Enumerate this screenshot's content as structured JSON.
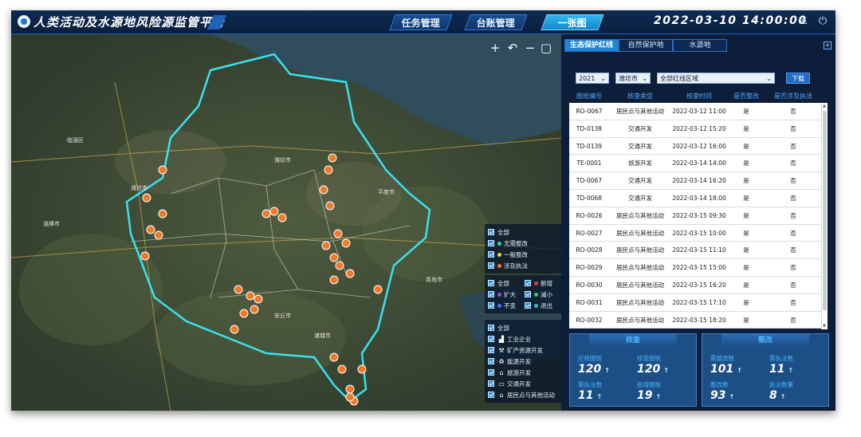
{
  "header": {
    "title": "人类活动及水源地风险源监管平台",
    "nav": [
      "任务管理",
      "台账管理",
      "一张图"
    ],
    "active_nav": 2,
    "datetime": "2022-03-10  14:00:00"
  },
  "map": {
    "controls": [
      "+",
      "↶",
      "−",
      "▢"
    ],
    "legend_status": [
      {
        "label": "全部",
        "color": ""
      },
      {
        "label": "无需整改",
        "color": "#2bd4c2"
      },
      {
        "label": "一般整改",
        "color": "#f2d33a"
      },
      {
        "label": "涉及执法",
        "color": "#f07a2a"
      }
    ],
    "legend_change": [
      {
        "label": "全部",
        "color": ""
      },
      {
        "label": "新增",
        "color": "#e23c3c"
      },
      {
        "label": "扩大",
        "color": "#a24cd8"
      },
      {
        "label": "减小",
        "color": "#2bd46a"
      },
      {
        "label": "不变",
        "color": "#3a7ff0"
      },
      {
        "label": "退出",
        "color": "#2bc4d4"
      }
    ],
    "legend_type": [
      {
        "label": "全部",
        "icon": ""
      },
      {
        "label": "工业企业",
        "icon": "factory-icon"
      },
      {
        "label": "矿产资源开发",
        "icon": "mining-icon"
      },
      {
        "label": "能源开发",
        "icon": "recycle-icon"
      },
      {
        "label": "旅游开发",
        "icon": "tourism-icon"
      },
      {
        "label": "交通开发",
        "icon": "bus-icon"
      },
      {
        "label": "居民点与其他活动",
        "icon": "residence-icon"
      }
    ]
  },
  "panel": {
    "tabs": [
      "生态保护红线",
      "自然保护地",
      "水源地"
    ],
    "active_tab": 0,
    "filters": {
      "year": "2021",
      "city": "潍坊市",
      "area": "全部红线区域"
    },
    "download_label": "下载",
    "columns": [
      "图斑编号",
      "核查类型",
      "核查时间",
      "是否整改",
      "是否涉及执法"
    ],
    "rows": [
      [
        "RO-0067",
        "居民点与其他活动",
        "2022-03-12 11:00",
        "是",
        "否"
      ],
      [
        "TD-0138",
        "交通开发",
        "2022-03-12 15:20",
        "是",
        "否"
      ],
      [
        "TD-0139",
        "交通开发",
        "2022-03-12 16:00",
        "是",
        "否"
      ],
      [
        "TE-0001",
        "旅游开发",
        "2022-03-14 14:00",
        "是",
        "否"
      ],
      [
        "TD-0067",
        "交通开发",
        "2022-03-14 16:20",
        "是",
        "否"
      ],
      [
        "TD-0068",
        "交通开发",
        "2022-03-14 18:00",
        "是",
        "否"
      ],
      [
        "RO-0026",
        "居民点与其他活动",
        "2022-03-15 09:30",
        "是",
        "否"
      ],
      [
        "RO-0027",
        "居民点与其他活动",
        "2022-03-15 10:00",
        "是",
        "否"
      ],
      [
        "RO-0028",
        "居民点与其他活动",
        "2022-03-15 11:10",
        "是",
        "否"
      ],
      [
        "RO-0029",
        "居民点与其他活动",
        "2022-03-15 15:00",
        "是",
        "否"
      ],
      [
        "RO-0030",
        "居民点与其他活动",
        "2022-03-15 16:20",
        "是",
        "否"
      ],
      [
        "RO-0031",
        "居民点与其他活动",
        "2022-03-15 17:10",
        "是",
        "否"
      ],
      [
        "RO-0032",
        "居民点与其他活动",
        "2022-03-15 18:20",
        "是",
        "否"
      ]
    ],
    "cards": [
      {
        "title": "核查",
        "stats": [
          {
            "label": "应核图斑",
            "value": "120"
          },
          {
            "label": "核查图斑",
            "value": "120"
          },
          {
            "label": "需执法数",
            "value": "11"
          },
          {
            "label": "新增图斑",
            "value": "19"
          }
        ]
      },
      {
        "title": "整改",
        "stats": [
          {
            "label": "需整改数",
            "value": "101"
          },
          {
            "label": "需执法数",
            "value": "11"
          },
          {
            "label": "整改数",
            "value": "93"
          },
          {
            "label": "执法数量",
            "value": "8"
          }
        ]
      }
    ]
  }
}
